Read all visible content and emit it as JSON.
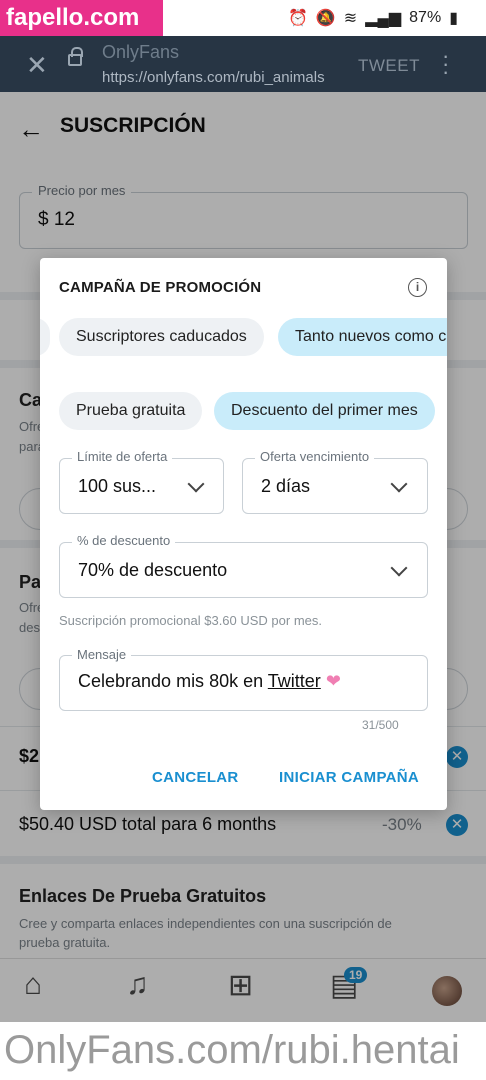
{
  "watermark": {
    "top": "fapello.com",
    "bottom": "OnlyFans.com/rubi.hentai"
  },
  "status_bar": {
    "battery": "87%"
  },
  "browser": {
    "title": "OnlyFans",
    "url": "https://onlyfans.com/rubi_animals",
    "tweet_label": "TWEET"
  },
  "header": {
    "title": "SUSCRIPCIÓN"
  },
  "price": {
    "label": "Precio por mes",
    "value": "$ 12"
  },
  "background": {
    "section1_title": "Ca",
    "section1_desc_l1": "Ofre",
    "section1_desc_l2": "para",
    "section2_title": "Pa",
    "section2_desc_l1": "Ofre",
    "section2_desc_l2": "desc",
    "bundle_row1_text": "$2",
    "bundle_row2_text": "$50.40 USD total para 6 months",
    "bundle_row2_pct": "-30%",
    "free_links_title": "Enlaces De Prueba Gratuitos",
    "free_links_desc_l1": "Cree y comparta enlaces independientes con una suscripción de",
    "free_links_desc_l2": "prueba gratuita."
  },
  "bottom_nav": {
    "messages_badge": "19"
  },
  "modal": {
    "title": "CAMPAÑA DE PROMOCIÓN",
    "audience_chips": [
      "Suscriptores caducados",
      "Tanto nuevos como caducados"
    ],
    "type_chips": [
      "Prueba gratuita",
      "Descuento del primer mes"
    ],
    "limit": {
      "label": "Límite de oferta",
      "value": "100 sus..."
    },
    "expiry": {
      "label": "Oferta vencimiento",
      "value": "2 días"
    },
    "discount": {
      "label": "% de descuento",
      "value": "70% de descuento"
    },
    "help_text": "Suscripción promocional $3.60 USD por mes.",
    "message": {
      "label": "Mensaje",
      "value_before": "Celebrando mis 80k en ",
      "value_link": "Twitter",
      "value_emoji": "❤"
    },
    "counter": "31/500",
    "cancel_label": "CANCELAR",
    "start_label": "INICIAR CAMPAÑA"
  }
}
